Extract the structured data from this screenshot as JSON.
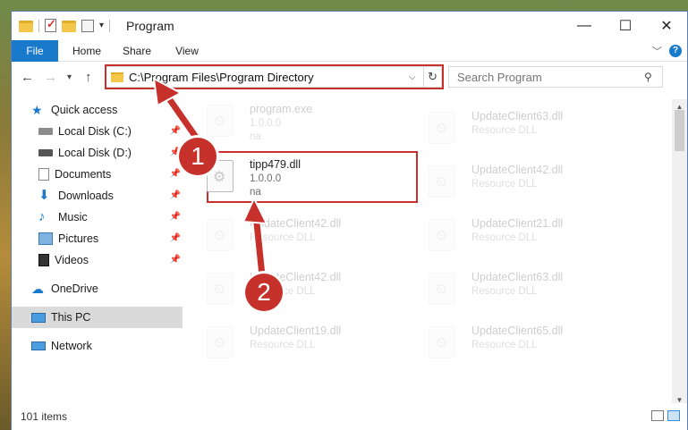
{
  "window": {
    "title": "Program"
  },
  "window_controls": {
    "minimize": "—",
    "maximize": "☐",
    "close": "✕"
  },
  "ribbon": {
    "tabs": [
      "File",
      "Home",
      "Share",
      "View"
    ],
    "help": "?"
  },
  "address": {
    "path": "C:\\Program Files\\Program Directory"
  },
  "search": {
    "placeholder": "Search Program"
  },
  "sidebar": {
    "items": [
      {
        "label": "Quick access",
        "icon": "star-icon"
      },
      {
        "label": "Local Disk (C:)",
        "icon": "drive-icon",
        "pinned": true
      },
      {
        "label": "Local Disk (D:)",
        "icon": "drive-icon",
        "pinned": true
      },
      {
        "label": "Documents",
        "icon": "documents-icon",
        "pinned": true
      },
      {
        "label": "Downloads",
        "icon": "download-icon",
        "pinned": true
      },
      {
        "label": "Music",
        "icon": "music-icon",
        "pinned": true
      },
      {
        "label": "Pictures",
        "icon": "pictures-icon",
        "pinned": true
      },
      {
        "label": "Videos",
        "icon": "videos-icon",
        "pinned": true
      },
      {
        "label": "OneDrive",
        "icon": "cloud-icon"
      },
      {
        "label": "This PC",
        "icon": "computer-icon",
        "selected": true
      },
      {
        "label": "Network",
        "icon": "network-icon"
      }
    ]
  },
  "files": {
    "left": [
      {
        "name": "program.exe",
        "sub1": "1.0.0.0",
        "sub2": "na"
      },
      {
        "name": "tipp479.dll",
        "sub1": "1.0.0.0",
        "sub2": "na",
        "highlighted": true
      },
      {
        "name": "UpdateClient42.dll",
        "sub1": "Resource DLL"
      },
      {
        "name": "UpdateClient42.dll",
        "sub1": "Resource DLL"
      },
      {
        "name": "UpdateClient19.dll",
        "sub1": "Resource DLL"
      }
    ],
    "right": [
      {
        "name": "UpdateClient63.dll",
        "sub1": "Resource DLL"
      },
      {
        "name": "UpdateClient42.dll",
        "sub1": "Resource DLL"
      },
      {
        "name": "UpdateClient21.dll",
        "sub1": "Resource DLL"
      },
      {
        "name": "UpdateClient63.dll",
        "sub1": "Resource DLL"
      },
      {
        "name": "UpdateClient65.dll",
        "sub1": "Resource DLL"
      }
    ]
  },
  "status": {
    "count": "101 items"
  },
  "annotations": {
    "badge1": "1",
    "badge2": "2",
    "color": "#c6312c"
  }
}
